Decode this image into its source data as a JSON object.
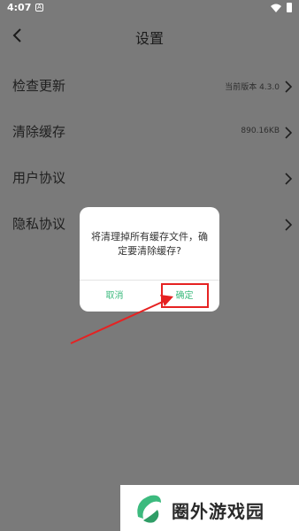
{
  "status_bar": {
    "time": "4:07",
    "badge": "A"
  },
  "header": {
    "title": "设置"
  },
  "settings": [
    {
      "label": "检查更新",
      "value": "当前版本 4.3.0"
    },
    {
      "label": "清除缓存",
      "value": "890.16KB"
    },
    {
      "label": "用户协议",
      "value": ""
    },
    {
      "label": "隐私协议",
      "value": ""
    }
  ],
  "dialog": {
    "message": "将清理掉所有缓存文件，确定要清除缓存?",
    "cancel_label": "取消",
    "confirm_label": "确定"
  },
  "watermark": {
    "text": "圈外游戏园"
  },
  "colors": {
    "accent": "#3cba7e",
    "highlight": "#e62222",
    "overlay": "#7a7a7a"
  }
}
